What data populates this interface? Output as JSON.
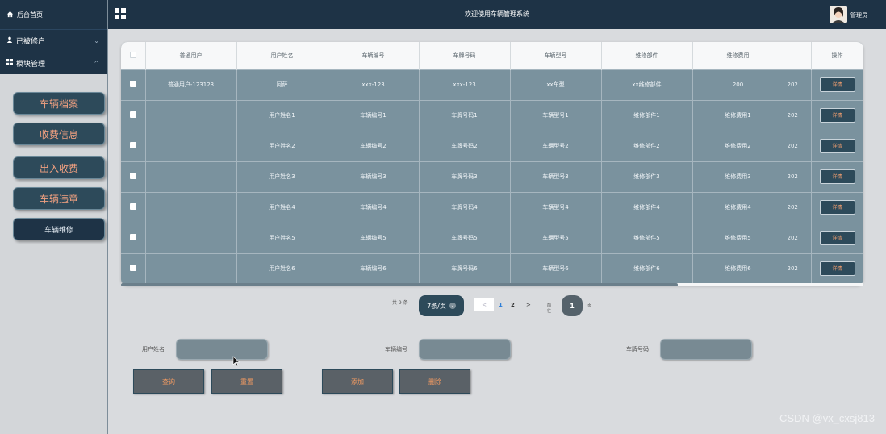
{
  "header": {
    "title": "欢迎使用车辆管理系统",
    "admin_label": "管理员"
  },
  "sidebar": {
    "home": "后台首页",
    "user_menu": "已被修户",
    "module_menu": "模块管理",
    "buttons": [
      "车辆档案",
      "收费信息",
      "出入收费",
      "车辆违章",
      "车辆维修"
    ]
  },
  "table": {
    "columns": [
      "普通用户",
      "用户姓名",
      "车辆编号",
      "车牌号码",
      "车辆型号",
      "维修部件",
      "维修费用",
      "",
      "操作"
    ],
    "rows": [
      [
        "普通用户-123123",
        "阿萨",
        "xxx-123",
        "xxx-123",
        "xx车型",
        "xx维修部件",
        "200",
        "202",
        "详情"
      ],
      [
        "",
        "用户姓名1",
        "车辆编号1",
        "车牌号码1",
        "车辆型号1",
        "维修部件1",
        "维修费用1",
        "202",
        "详情"
      ],
      [
        "",
        "用户姓名2",
        "车辆编号2",
        "车牌号码2",
        "车辆型号2",
        "维修部件2",
        "维修费用2",
        "202",
        "详情"
      ],
      [
        "",
        "用户姓名3",
        "车辆编号3",
        "车牌号码3",
        "车辆型号3",
        "维修部件3",
        "维修费用3",
        "202",
        "详情"
      ],
      [
        "",
        "用户姓名4",
        "车辆编号4",
        "车牌号码4",
        "车辆型号4",
        "维修部件4",
        "维修费用4",
        "202",
        "详情"
      ],
      [
        "",
        "用户姓名5",
        "车辆编号5",
        "车牌号码5",
        "车辆型号5",
        "维修部件5",
        "维修费用5",
        "202",
        "详情"
      ],
      [
        "",
        "用户姓名6",
        "车辆编号6",
        "车牌号码6",
        "车辆型号6",
        "维修部件6",
        "维修费用6",
        "202",
        "详情"
      ]
    ]
  },
  "pagination": {
    "total": "共 9 条",
    "page_size": "7条/页",
    "prev": "<",
    "pages": [
      "1",
      "2"
    ],
    "next": ">",
    "goto_label": "前往",
    "goto_value": "1",
    "goto_unit": "页"
  },
  "search": {
    "user_name_label": "用户姓名",
    "vehicle_no_label": "车辆编号",
    "plate_label": "车牌号码"
  },
  "actions": {
    "query": "查询",
    "reset": "重置",
    "add": "添加",
    "delete": "删除"
  },
  "watermark": "CSDN @vx_cxsj813",
  "colors": {
    "nav_dark": "#1e3346",
    "table_body": "#7a929e",
    "accent_orange": "#f39b62"
  }
}
